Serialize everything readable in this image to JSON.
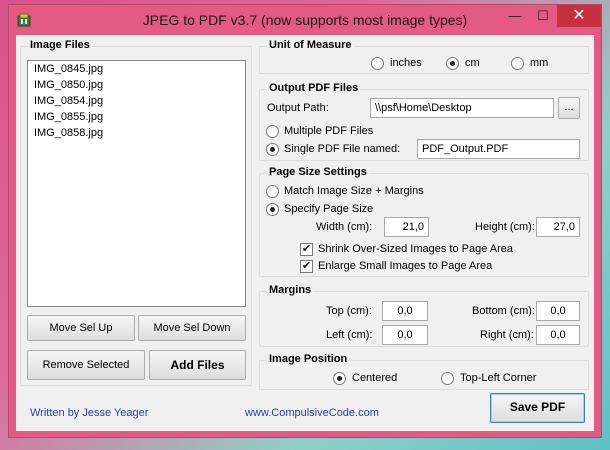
{
  "window": {
    "title": "JPEG to PDF  v3.7    (now supports most image types)",
    "minimize": "—",
    "maximize": "☐",
    "close": "✕"
  },
  "image_files": {
    "title": "Image Files",
    "items": [
      "IMG_0845.jpg",
      "IMG_0850.jpg",
      "IMG_0854.jpg",
      "IMG_0855.jpg",
      "IMG_0858.jpg"
    ],
    "move_up": "Move Sel Up",
    "move_down": "Move Sel Down",
    "remove": "Remove Selected",
    "add": "Add Files"
  },
  "unit": {
    "title": "Unit of Measure",
    "options": [
      "inches",
      "cm",
      "mm"
    ],
    "selected": "cm"
  },
  "output": {
    "title": "Output PDF Files",
    "path_label": "Output Path:",
    "path_value": "\\\\psf\\Home\\Desktop",
    "browse": "...",
    "multiple_label": "Multiple PDF Files",
    "single_label": "Single PDF File named:",
    "single_value": "PDF_Output.PDF",
    "selected": "single"
  },
  "page_size": {
    "title": "Page Size Settings",
    "match_label": "Match Image Size + Margins",
    "specify_label": "Specify Page Size",
    "selected": "specify",
    "width_label": "Width (cm):",
    "width_value": "21,0",
    "height_label": "Height (cm):",
    "height_value": "27,0",
    "shrink_label": "Shrink Over-Sized Images to Page Area",
    "enlarge_label": "Enlarge Small Images to Page Area",
    "check_mark": "✔"
  },
  "margins": {
    "title": "Margins",
    "top_label": "Top (cm):",
    "top_value": "0,0",
    "bottom_label": "Bottom (cm):",
    "bottom_value": "0,0",
    "left_label": "Left (cm):",
    "left_value": "0,0",
    "right_label": "Right (cm):",
    "right_value": "0,0"
  },
  "position": {
    "title": "Image Position",
    "centered": "Centered",
    "top_left": "Top-Left Corner",
    "selected": "centered"
  },
  "footer": {
    "author": "Written by Jesse Yeager",
    "website": "www.CompulsiveCode.com",
    "save": "Save PDF"
  },
  "colors": {
    "title_bar": "#e35a85",
    "close_button": "#c7303c",
    "link": "#1f3fbf"
  }
}
